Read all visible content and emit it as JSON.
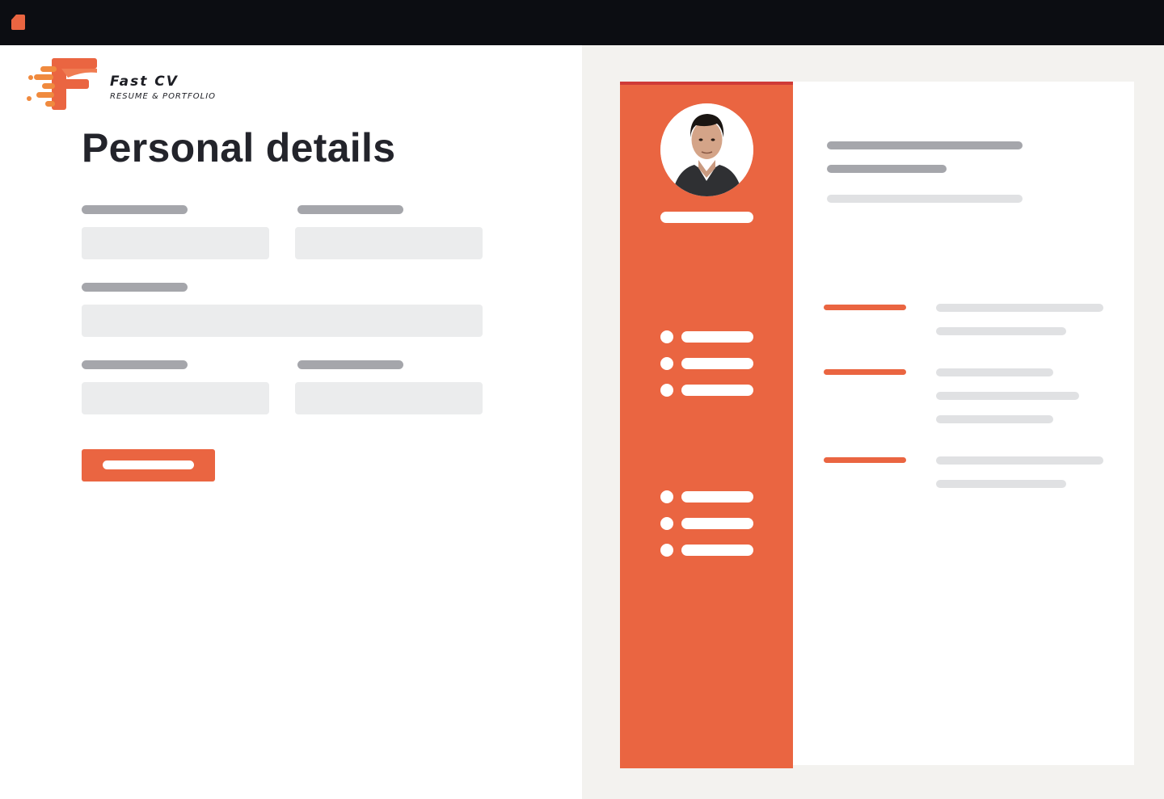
{
  "window": {
    "app_icon": "app-icon"
  },
  "brand": {
    "name": "Fast CV",
    "tagline": "RESUME & PORTFOLIO",
    "accent_color": "#ea6541",
    "logo_icon": "fast-f-logo-icon"
  },
  "form": {
    "title": "Personal details",
    "rows": [
      {
        "fields": 2
      },
      {
        "fields": 1
      },
      {
        "fields": 2
      }
    ]
  },
  "preview": {
    "sidebar_color": "#ea6541",
    "avatar_icon": "profile-photo",
    "sidebar_list_groups": 2,
    "items_per_group": 3,
    "sections": 3
  }
}
